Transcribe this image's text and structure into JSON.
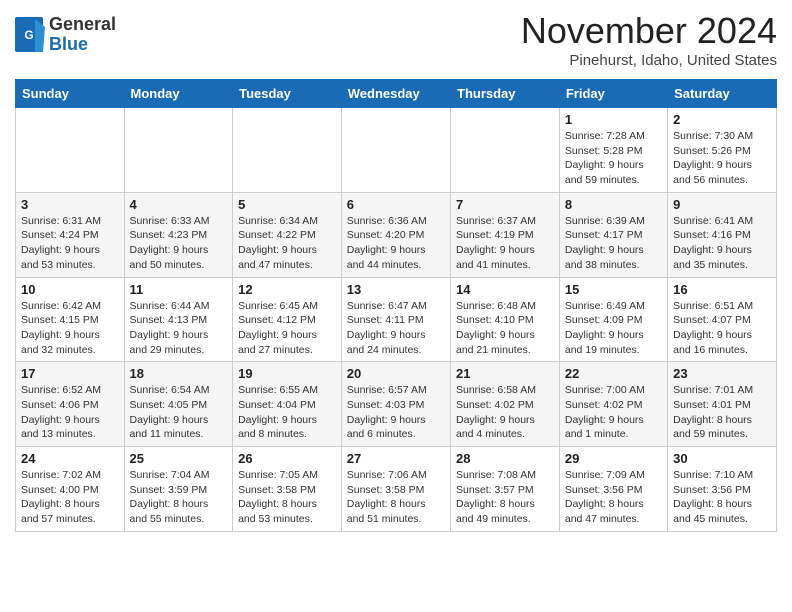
{
  "header": {
    "logo_general": "General",
    "logo_blue": "Blue",
    "month": "November 2024",
    "location": "Pinehurst, Idaho, United States"
  },
  "weekdays": [
    "Sunday",
    "Monday",
    "Tuesday",
    "Wednesday",
    "Thursday",
    "Friday",
    "Saturday"
  ],
  "weeks": [
    [
      {
        "day": "",
        "info": ""
      },
      {
        "day": "",
        "info": ""
      },
      {
        "day": "",
        "info": ""
      },
      {
        "day": "",
        "info": ""
      },
      {
        "day": "",
        "info": ""
      },
      {
        "day": "1",
        "info": "Sunrise: 7:28 AM\nSunset: 5:28 PM\nDaylight: 9 hours and 59 minutes."
      },
      {
        "day": "2",
        "info": "Sunrise: 7:30 AM\nSunset: 5:26 PM\nDaylight: 9 hours and 56 minutes."
      }
    ],
    [
      {
        "day": "3",
        "info": "Sunrise: 6:31 AM\nSunset: 4:24 PM\nDaylight: 9 hours and 53 minutes."
      },
      {
        "day": "4",
        "info": "Sunrise: 6:33 AM\nSunset: 4:23 PM\nDaylight: 9 hours and 50 minutes."
      },
      {
        "day": "5",
        "info": "Sunrise: 6:34 AM\nSunset: 4:22 PM\nDaylight: 9 hours and 47 minutes."
      },
      {
        "day": "6",
        "info": "Sunrise: 6:36 AM\nSunset: 4:20 PM\nDaylight: 9 hours and 44 minutes."
      },
      {
        "day": "7",
        "info": "Sunrise: 6:37 AM\nSunset: 4:19 PM\nDaylight: 9 hours and 41 minutes."
      },
      {
        "day": "8",
        "info": "Sunrise: 6:39 AM\nSunset: 4:17 PM\nDaylight: 9 hours and 38 minutes."
      },
      {
        "day": "9",
        "info": "Sunrise: 6:41 AM\nSunset: 4:16 PM\nDaylight: 9 hours and 35 minutes."
      }
    ],
    [
      {
        "day": "10",
        "info": "Sunrise: 6:42 AM\nSunset: 4:15 PM\nDaylight: 9 hours and 32 minutes."
      },
      {
        "day": "11",
        "info": "Sunrise: 6:44 AM\nSunset: 4:13 PM\nDaylight: 9 hours and 29 minutes."
      },
      {
        "day": "12",
        "info": "Sunrise: 6:45 AM\nSunset: 4:12 PM\nDaylight: 9 hours and 27 minutes."
      },
      {
        "day": "13",
        "info": "Sunrise: 6:47 AM\nSunset: 4:11 PM\nDaylight: 9 hours and 24 minutes."
      },
      {
        "day": "14",
        "info": "Sunrise: 6:48 AM\nSunset: 4:10 PM\nDaylight: 9 hours and 21 minutes."
      },
      {
        "day": "15",
        "info": "Sunrise: 6:49 AM\nSunset: 4:09 PM\nDaylight: 9 hours and 19 minutes."
      },
      {
        "day": "16",
        "info": "Sunrise: 6:51 AM\nSunset: 4:07 PM\nDaylight: 9 hours and 16 minutes."
      }
    ],
    [
      {
        "day": "17",
        "info": "Sunrise: 6:52 AM\nSunset: 4:06 PM\nDaylight: 9 hours and 13 minutes."
      },
      {
        "day": "18",
        "info": "Sunrise: 6:54 AM\nSunset: 4:05 PM\nDaylight: 9 hours and 11 minutes."
      },
      {
        "day": "19",
        "info": "Sunrise: 6:55 AM\nSunset: 4:04 PM\nDaylight: 9 hours and 8 minutes."
      },
      {
        "day": "20",
        "info": "Sunrise: 6:57 AM\nSunset: 4:03 PM\nDaylight: 9 hours and 6 minutes."
      },
      {
        "day": "21",
        "info": "Sunrise: 6:58 AM\nSunset: 4:02 PM\nDaylight: 9 hours and 4 minutes."
      },
      {
        "day": "22",
        "info": "Sunrise: 7:00 AM\nSunset: 4:02 PM\nDaylight: 9 hours and 1 minute."
      },
      {
        "day": "23",
        "info": "Sunrise: 7:01 AM\nSunset: 4:01 PM\nDaylight: 8 hours and 59 minutes."
      }
    ],
    [
      {
        "day": "24",
        "info": "Sunrise: 7:02 AM\nSunset: 4:00 PM\nDaylight: 8 hours and 57 minutes."
      },
      {
        "day": "25",
        "info": "Sunrise: 7:04 AM\nSunset: 3:59 PM\nDaylight: 8 hours and 55 minutes."
      },
      {
        "day": "26",
        "info": "Sunrise: 7:05 AM\nSunset: 3:58 PM\nDaylight: 8 hours and 53 minutes."
      },
      {
        "day": "27",
        "info": "Sunrise: 7:06 AM\nSunset: 3:58 PM\nDaylight: 8 hours and 51 minutes."
      },
      {
        "day": "28",
        "info": "Sunrise: 7:08 AM\nSunset: 3:57 PM\nDaylight: 8 hours and 49 minutes."
      },
      {
        "day": "29",
        "info": "Sunrise: 7:09 AM\nSunset: 3:56 PM\nDaylight: 8 hours and 47 minutes."
      },
      {
        "day": "30",
        "info": "Sunrise: 7:10 AM\nSunset: 3:56 PM\nDaylight: 8 hours and 45 minutes."
      }
    ]
  ]
}
